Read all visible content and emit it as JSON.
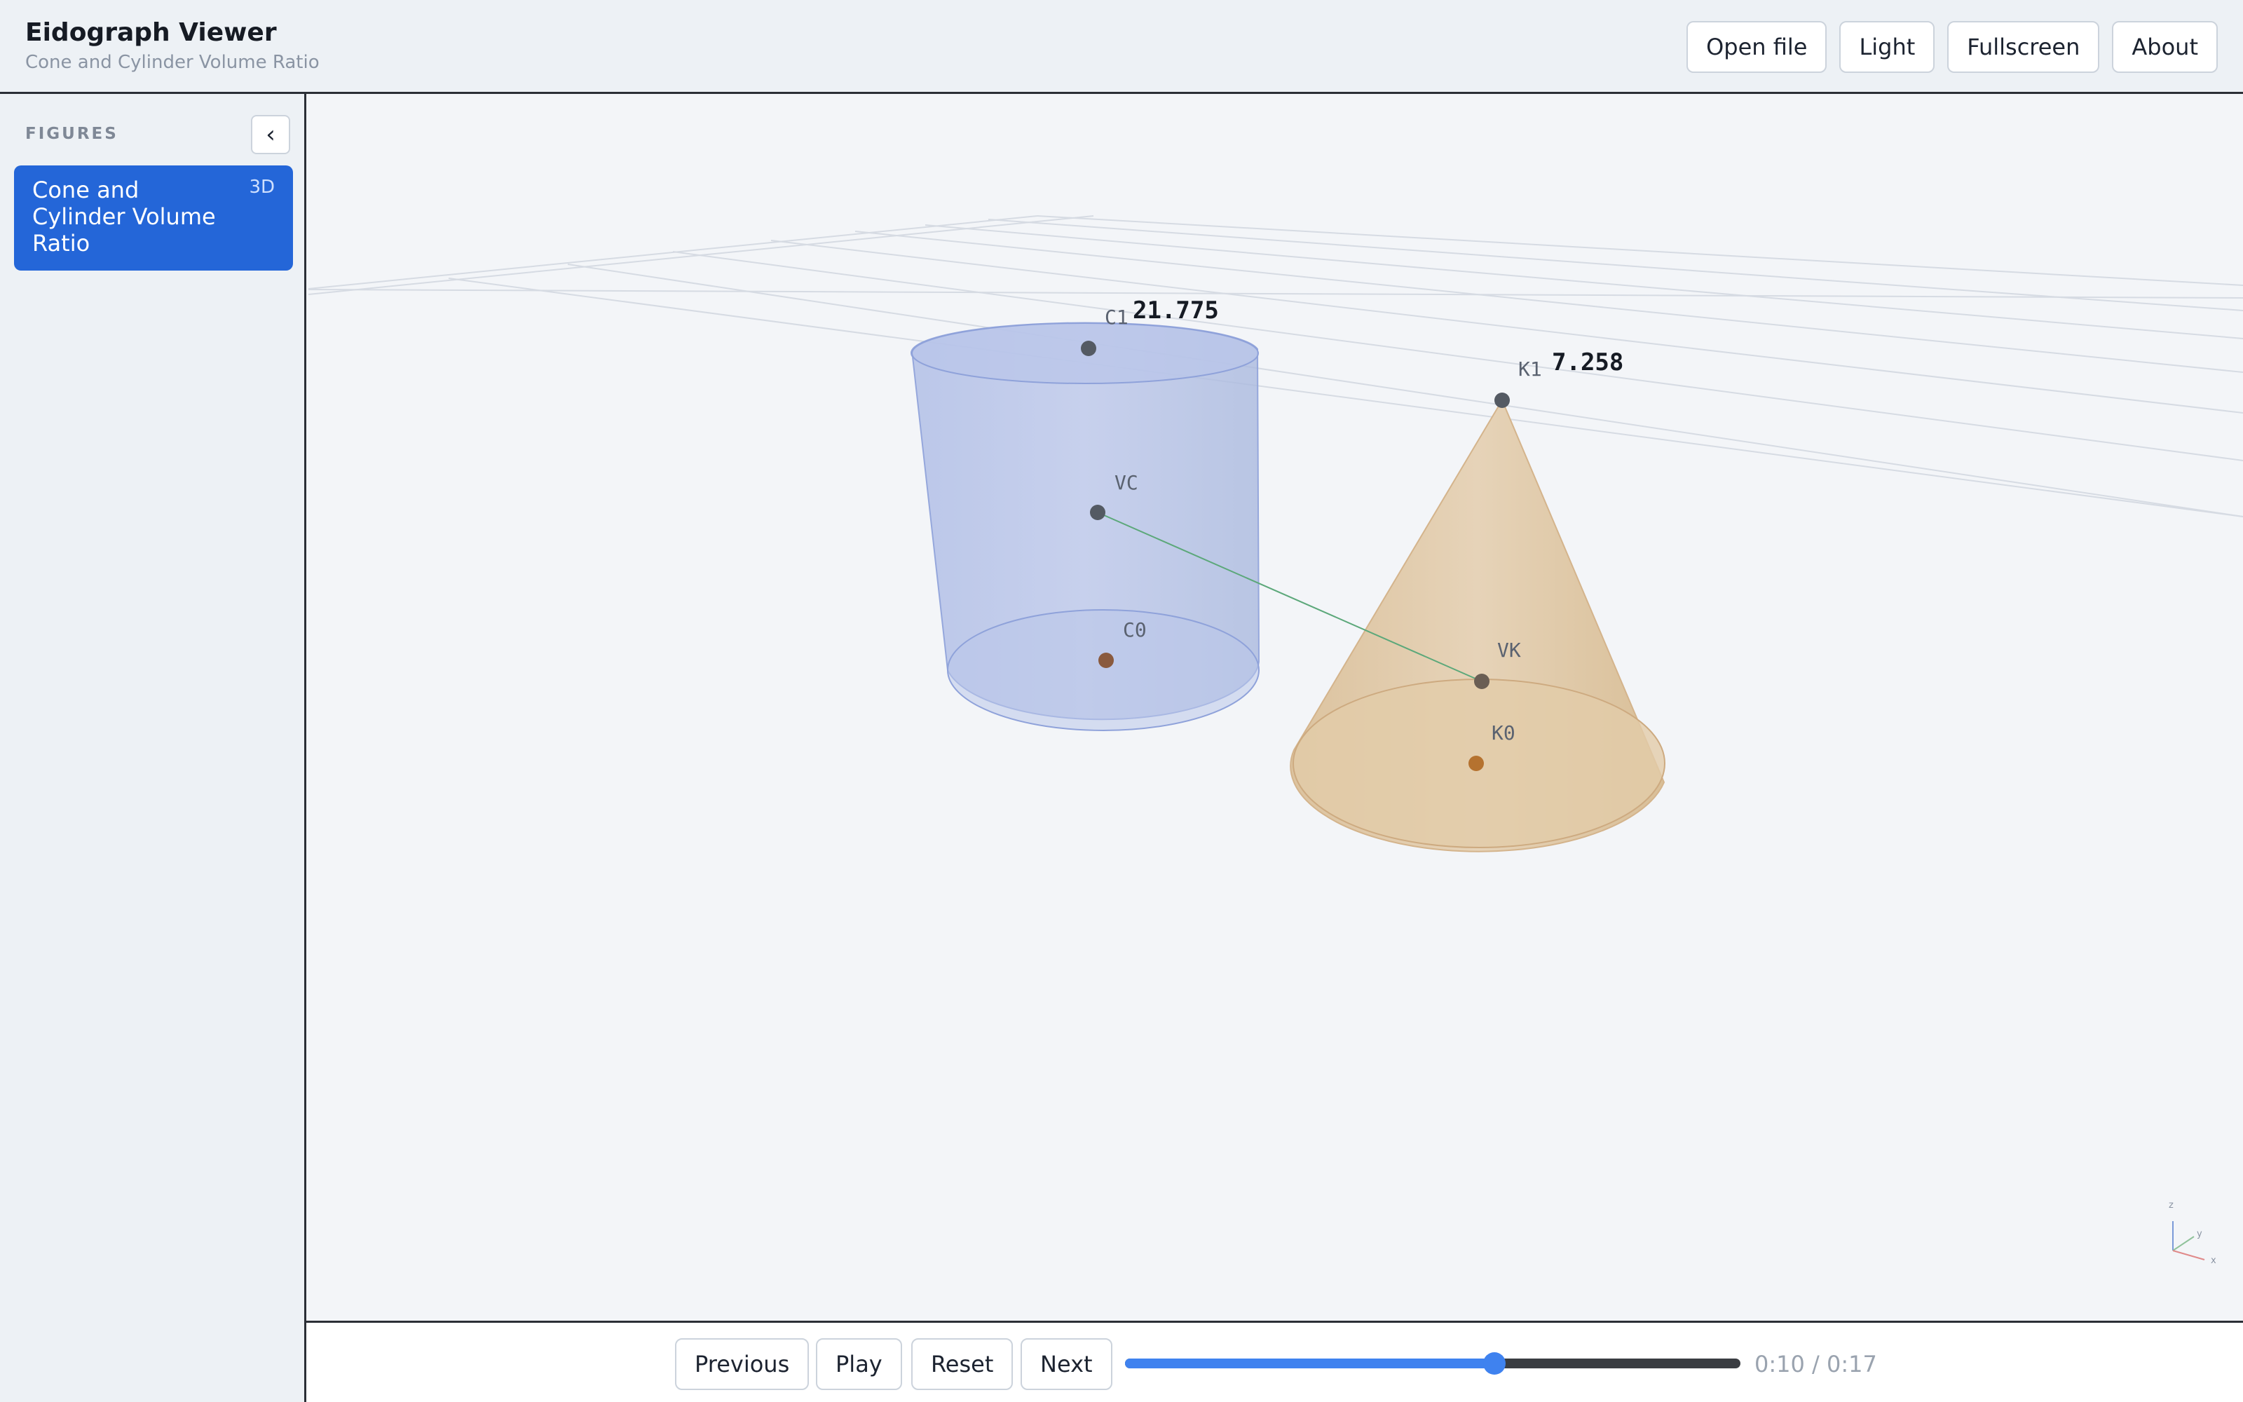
{
  "header": {
    "title": "Eidograph Viewer",
    "subtitle": "Cone and Cylinder Volume Ratio",
    "buttons": {
      "open_file": "Open file",
      "theme": "Light",
      "fullscreen": "Fullscreen",
      "about": "About"
    }
  },
  "sidebar": {
    "label": "FIGURES",
    "collapse_icon": "chevron-left-icon",
    "collapse_glyph": "‹",
    "items": [
      {
        "title": "Cone and Cylinder Volume Ratio",
        "badge": "3D",
        "selected": true
      }
    ]
  },
  "scene": {
    "points": {
      "c1": "C1",
      "vc": "VC",
      "c0": "C0",
      "k1": "K1",
      "vk": "VK",
      "k0": "K0"
    },
    "values": {
      "cylinder_volume": "21.775",
      "cone_volume": "7.258"
    },
    "axes": {
      "z": "z",
      "y": "y",
      "x": "x"
    },
    "colors": {
      "cylinder": "#aebde6",
      "cone": "#e2c9a6",
      "connector": "#5ca87a",
      "point_dark": "#545a63",
      "point_brown": "#8a5a3e",
      "point_orange": "#b5722f"
    }
  },
  "playback": {
    "previous": "Previous",
    "play": "Play",
    "reset": "Reset",
    "next": "Next",
    "progress": 0.6,
    "time": "0:10 / 0:17"
  }
}
